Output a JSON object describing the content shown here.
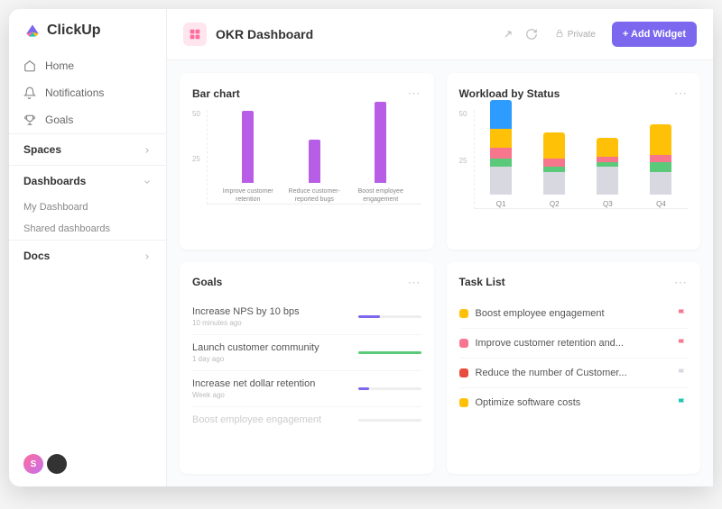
{
  "logo": "ClickUp",
  "nav": [
    {
      "icon": "home",
      "label": "Home"
    },
    {
      "icon": "bell",
      "label": "Notifications"
    },
    {
      "icon": "trophy",
      "label": "Goals"
    }
  ],
  "sections": {
    "spaces": {
      "label": "Spaces",
      "expanded": false
    },
    "dashboards": {
      "label": "Dashboards",
      "expanded": true,
      "items": [
        "My Dashboard",
        "Shared dashboards"
      ]
    },
    "docs": {
      "label": "Docs",
      "expanded": false
    }
  },
  "header": {
    "title": "OKR Dashboard",
    "privacy": "Private",
    "add_widget": "+ Add Widget"
  },
  "cards": {
    "bar": {
      "title": "Bar chart"
    },
    "workload": {
      "title": "Workload by Status"
    },
    "goals": {
      "title": "Goals"
    },
    "tasks": {
      "title": "Task List"
    }
  },
  "chart_data": [
    {
      "type": "bar",
      "title": "Bar chart",
      "ylim": [
        0,
        50
      ],
      "ticks": [
        25,
        50
      ],
      "categories": [
        "Improve customer retention",
        "Reduce customer-reported bugs",
        "Boost employee engagement"
      ],
      "values": [
        40,
        24,
        45
      ],
      "color": "#b85ee6"
    },
    {
      "type": "bar_stacked",
      "title": "Workload by Status",
      "ylim": [
        0,
        50
      ],
      "ticks": [
        25,
        50
      ],
      "categories": [
        "Q1",
        "Q2",
        "Q3",
        "Q4"
      ],
      "series": [
        {
          "name": "grey",
          "color": "#d8d8e0",
          "values": [
            15,
            12,
            15,
            12
          ]
        },
        {
          "name": "green",
          "color": "#5bc97a",
          "values": [
            4,
            3,
            2,
            5
          ]
        },
        {
          "name": "pink",
          "color": "#f7768e",
          "values": [
            6,
            4,
            3,
            4
          ]
        },
        {
          "name": "yellow",
          "color": "#ffc107",
          "values": [
            10,
            14,
            10,
            16
          ]
        },
        {
          "name": "blue",
          "color": "#2e9bff",
          "values": [
            15,
            0,
            0,
            0
          ]
        }
      ]
    }
  ],
  "goals": [
    {
      "title": "Increase NPS by 10 bps",
      "time": "10 minutes ago",
      "progress": 35,
      "color": "#7b68ee"
    },
    {
      "title": "Launch customer community",
      "time": "1 day ago",
      "progress": 100,
      "color": "#5bc97a"
    },
    {
      "title": "Increase net dollar retention",
      "time": "Week ago",
      "progress": 18,
      "color": "#7b68ee"
    },
    {
      "title": "Boost employee engagement",
      "time": "",
      "progress": 0,
      "color": "#ccc",
      "faded": true
    }
  ],
  "tasks": [
    {
      "dot": "#ffc107",
      "label": "Boost employee engagement",
      "flag": "#f7768e"
    },
    {
      "dot": "#f7768e",
      "label": "Improve customer retention and...",
      "flag": "#f7768e"
    },
    {
      "dot": "#e74c3c",
      "label": "Reduce the number of Customer...",
      "flag": "#d8d8e0"
    },
    {
      "dot": "#ffc107",
      "label": "Optimize software costs",
      "flag": "#1fc5b5"
    }
  ],
  "avatar_letter": "S"
}
